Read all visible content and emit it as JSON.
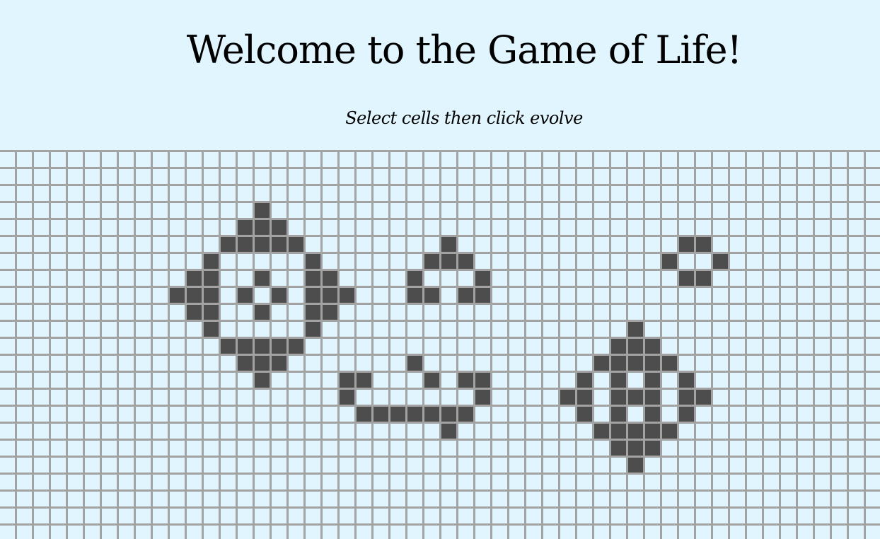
{
  "header": {
    "title": "Welcome to the Game of Life!",
    "subtitle": "Select cells then click evolve"
  },
  "board": {
    "columns": 52,
    "rows": 23,
    "colors": {
      "background": "#e1f5fe",
      "grid_line": "#a3a3a3",
      "alive_cell": "#4d4d4d"
    },
    "alive_cells": [
      [
        3,
        15
      ],
      [
        4,
        14
      ],
      [
        4,
        15
      ],
      [
        4,
        16
      ],
      [
        5,
        13
      ],
      [
        5,
        14
      ],
      [
        5,
        15
      ],
      [
        5,
        16
      ],
      [
        5,
        17
      ],
      [
        5,
        26
      ],
      [
        5,
        40
      ],
      [
        5,
        41
      ],
      [
        6,
        12
      ],
      [
        6,
        18
      ],
      [
        6,
        25
      ],
      [
        6,
        26
      ],
      [
        6,
        27
      ],
      [
        6,
        39
      ],
      [
        6,
        42
      ],
      [
        7,
        11
      ],
      [
        7,
        12
      ],
      [
        7,
        15
      ],
      [
        7,
        18
      ],
      [
        7,
        19
      ],
      [
        7,
        24
      ],
      [
        7,
        28
      ],
      [
        7,
        40
      ],
      [
        7,
        41
      ],
      [
        8,
        10
      ],
      [
        8,
        11
      ],
      [
        8,
        12
      ],
      [
        8,
        14
      ],
      [
        8,
        16
      ],
      [
        8,
        18
      ],
      [
        8,
        19
      ],
      [
        8,
        20
      ],
      [
        8,
        24
      ],
      [
        8,
        25
      ],
      [
        8,
        27
      ],
      [
        8,
        28
      ],
      [
        9,
        11
      ],
      [
        9,
        12
      ],
      [
        9,
        15
      ],
      [
        9,
        18
      ],
      [
        9,
        19
      ],
      [
        10,
        12
      ],
      [
        10,
        18
      ],
      [
        10,
        37
      ],
      [
        11,
        13
      ],
      [
        11,
        14
      ],
      [
        11,
        15
      ],
      [
        11,
        16
      ],
      [
        11,
        17
      ],
      [
        11,
        36
      ],
      [
        11,
        37
      ],
      [
        11,
        38
      ],
      [
        12,
        14
      ],
      [
        12,
        15
      ],
      [
        12,
        16
      ],
      [
        12,
        24
      ],
      [
        12,
        35
      ],
      [
        12,
        36
      ],
      [
        12,
        37
      ],
      [
        12,
        38
      ],
      [
        12,
        39
      ],
      [
        13,
        15
      ],
      [
        13,
        20
      ],
      [
        13,
        21
      ],
      [
        13,
        25
      ],
      [
        13,
        27
      ],
      [
        13,
        28
      ],
      [
        13,
        34
      ],
      [
        13,
        36
      ],
      [
        13,
        38
      ],
      [
        13,
        40
      ],
      [
        14,
        20
      ],
      [
        14,
        28
      ],
      [
        14,
        33
      ],
      [
        14,
        34
      ],
      [
        14,
        36
      ],
      [
        14,
        37
      ],
      [
        14,
        38
      ],
      [
        14,
        40
      ],
      [
        14,
        41
      ],
      [
        15,
        21
      ],
      [
        15,
        22
      ],
      [
        15,
        23
      ],
      [
        15,
        24
      ],
      [
        15,
        25
      ],
      [
        15,
        26
      ],
      [
        15,
        27
      ],
      [
        15,
        34
      ],
      [
        15,
        36
      ],
      [
        15,
        38
      ],
      [
        15,
        40
      ],
      [
        16,
        26
      ],
      [
        16,
        35
      ],
      [
        16,
        36
      ],
      [
        16,
        37
      ],
      [
        16,
        38
      ],
      [
        16,
        39
      ],
      [
        17,
        36
      ],
      [
        17,
        37
      ],
      [
        17,
        38
      ],
      [
        18,
        37
      ]
    ]
  }
}
